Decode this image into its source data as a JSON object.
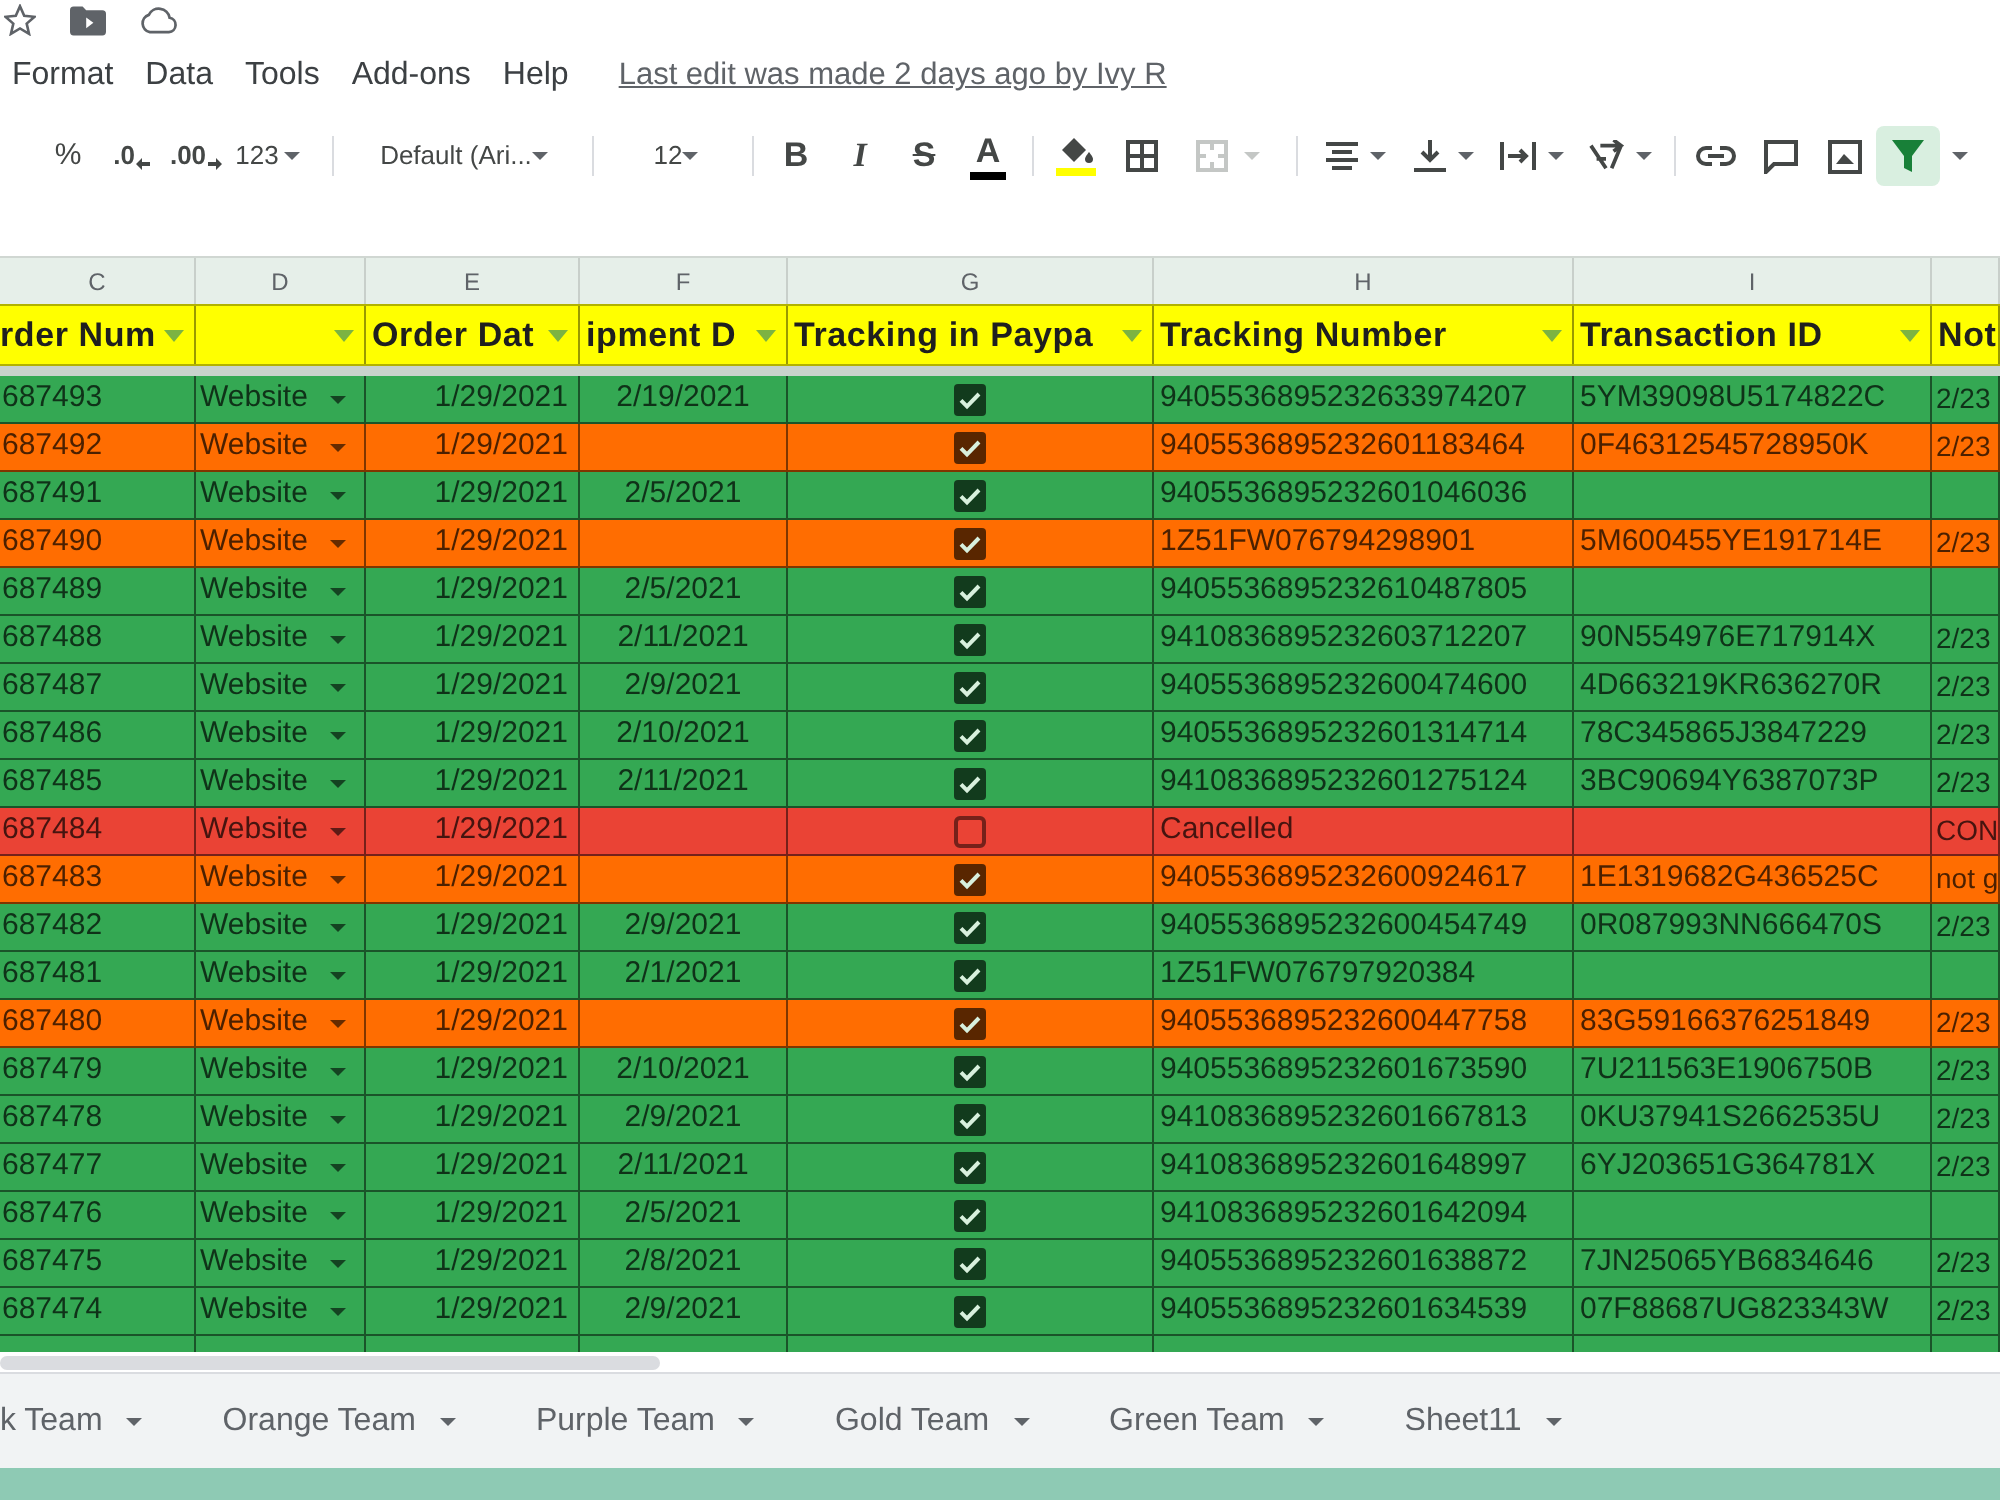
{
  "menu": {
    "items": [
      "Format",
      "Data",
      "Tools",
      "Add-ons",
      "Help"
    ],
    "last_edit": "Last edit was made 2 days ago by Ivy R"
  },
  "toolbar": {
    "percent": "%",
    "decrease_decimals": ".0",
    "increase_decimals": ".00",
    "number_format": "123",
    "font": "Default (Ari...",
    "font_size": "12",
    "text_styles": [
      {
        "kind": "bold",
        "label": "B"
      },
      {
        "kind": "italic",
        "label": "I"
      },
      {
        "kind": "strikethrough",
        "label": "S"
      },
      {
        "kind": "text_color",
        "label": "A"
      }
    ],
    "merge_disabled": true,
    "filter_on": true
  },
  "columns": [
    {
      "letter": "C",
      "title": "rder Num",
      "filter": true
    },
    {
      "letter": "D",
      "filter": true
    },
    {
      "letter": "E",
      "title": "Order Dat",
      "filter": true
    },
    {
      "letter": "F",
      "title": "ipment D",
      "filter": true
    },
    {
      "letter": "G",
      "title": "Tracking in Paypa",
      "filter": true
    },
    {
      "letter": "H",
      "title": "Tracking Number",
      "filter": true
    },
    {
      "letter": "I",
      "title": "Transaction ID",
      "filter": true
    },
    {
      "title": "Not"
    }
  ],
  "rows": [
    {
      "color": "#34a853",
      "order": "687493",
      "source": "Website",
      "order_date": "1/29/2021",
      "ship_date": "2/19/2021",
      "checked": true,
      "tracking": "9405536895232633974207",
      "transaction": "5YM39098U5174822C",
      "notes": "2/23"
    },
    {
      "color": "#ff6d01",
      "order": "687492",
      "source": "Website",
      "order_date": "1/29/2021",
      "checked": true,
      "tracking": "9405536895232601183464",
      "transaction": "0F46312545728950K",
      "notes": "2/23"
    },
    {
      "color": "#34a853",
      "order": "687491",
      "source": "Website",
      "order_date": "1/29/2021",
      "ship_date": "2/5/2021",
      "checked": true,
      "tracking": "9405536895232601046036"
    },
    {
      "color": "#ff6d01",
      "order": "687490",
      "source": "Website",
      "order_date": "1/29/2021",
      "checked": true,
      "tracking": "1Z51FW076794298901",
      "transaction": "5M600455YE191714E",
      "notes": "2/23"
    },
    {
      "color": "#34a853",
      "order": "687489",
      "source": "Website",
      "order_date": "1/29/2021",
      "ship_date": "2/5/2021",
      "checked": true,
      "tracking": "9405536895232610487805"
    },
    {
      "color": "#34a853",
      "order": "687488",
      "source": "Website",
      "order_date": "1/29/2021",
      "ship_date": "2/11/2021",
      "checked": true,
      "tracking": "9410836895232603712207",
      "transaction": "90N554976E717914X",
      "notes": "2/23"
    },
    {
      "color": "#34a853",
      "order": "687487",
      "source": "Website",
      "order_date": "1/29/2021",
      "ship_date": "2/9/2021",
      "checked": true,
      "tracking": "9405536895232600474600",
      "transaction": "4D663219KR636270R",
      "notes": "2/23"
    },
    {
      "color": "#34a853",
      "order": "687486",
      "source": "Website",
      "order_date": "1/29/2021",
      "ship_date": "2/10/2021",
      "checked": true,
      "tracking": "9405536895232601314714",
      "transaction": "78C345865J3847229",
      "notes": "2/23"
    },
    {
      "color": "#34a853",
      "order": "687485",
      "source": "Website",
      "order_date": "1/29/2021",
      "ship_date": "2/11/2021",
      "checked": true,
      "tracking": "9410836895232601275124",
      "transaction": "3BC90694Y6387073P",
      "notes": "2/23"
    },
    {
      "color": "#ea4335",
      "order": "687484",
      "source": "Website",
      "order_date": "1/29/2021",
      "checked": false,
      "tracking": "Cancelled",
      "notes": "CON"
    },
    {
      "color": "#ff6d01",
      "order": "687483",
      "source": "Website",
      "order_date": "1/29/2021",
      "checked": true,
      "tracking": "9405536895232600924617",
      "transaction": "1E1319682G436525C",
      "notes": "not g"
    },
    {
      "color": "#34a853",
      "order": "687482",
      "source": "Website",
      "order_date": "1/29/2021",
      "ship_date": "2/9/2021",
      "checked": true,
      "tracking": "9405536895232600454749",
      "transaction": "0R087993NN666470S",
      "notes": "2/23"
    },
    {
      "color": "#34a853",
      "order": "687481",
      "source": "Website",
      "order_date": "1/29/2021",
      "ship_date": "2/1/2021",
      "checked": true,
      "tracking": "1Z51FW076797920384"
    },
    {
      "color": "#ff6d01",
      "order": "687480",
      "source": "Website",
      "order_date": "1/29/2021",
      "checked": true,
      "tracking": "9405536895232600447758",
      "transaction": "83G59166376251849",
      "notes": "2/23"
    },
    {
      "color": "#34a853",
      "order": "687479",
      "source": "Website",
      "order_date": "1/29/2021",
      "ship_date": "2/10/2021",
      "checked": true,
      "tracking": "9405536895232601673590",
      "transaction": "7U211563E1906750B",
      "notes": "2/23"
    },
    {
      "color": "#34a853",
      "order": "687478",
      "source": "Website",
      "order_date": "1/29/2021",
      "ship_date": "2/9/2021",
      "checked": true,
      "tracking": "9410836895232601667813",
      "transaction": "0KU37941S2662535U",
      "notes": "2/23"
    },
    {
      "color": "#34a853",
      "order": "687477",
      "source": "Website",
      "order_date": "1/29/2021",
      "ship_date": "2/11/2021",
      "checked": true,
      "tracking": "9410836895232601648997",
      "transaction": "6YJ203651G364781X",
      "notes": "2/23"
    },
    {
      "color": "#34a853",
      "order": "687476",
      "source": "Website",
      "order_date": "1/29/2021",
      "ship_date": "2/5/2021",
      "checked": true,
      "tracking": "9410836895232601642094"
    },
    {
      "color": "#34a853",
      "order": "687475",
      "source": "Website",
      "order_date": "1/29/2021",
      "ship_date": "2/8/2021",
      "checked": true,
      "tracking": "9405536895232601638872",
      "transaction": "7JN25065YB6834646",
      "notes": "2/23"
    },
    {
      "color": "#34a853",
      "order": "687474",
      "source": "Website",
      "order_date": "1/29/2021",
      "ship_date": "2/9/2021",
      "checked": true,
      "tracking": "9405536895232601634539",
      "transaction": "07F88687UG823343W",
      "notes": "2/23"
    }
  ],
  "sheet_tabs": [
    {
      "label": "k Team",
      "selected": false
    },
    {
      "label": "Orange Team",
      "selected": false
    },
    {
      "label": "Purple Team",
      "selected": false
    },
    {
      "label": "Gold Team",
      "selected": false
    },
    {
      "label": "Green Team",
      "selected": false
    },
    {
      "label": "Sheet11",
      "selected": false
    }
  ]
}
